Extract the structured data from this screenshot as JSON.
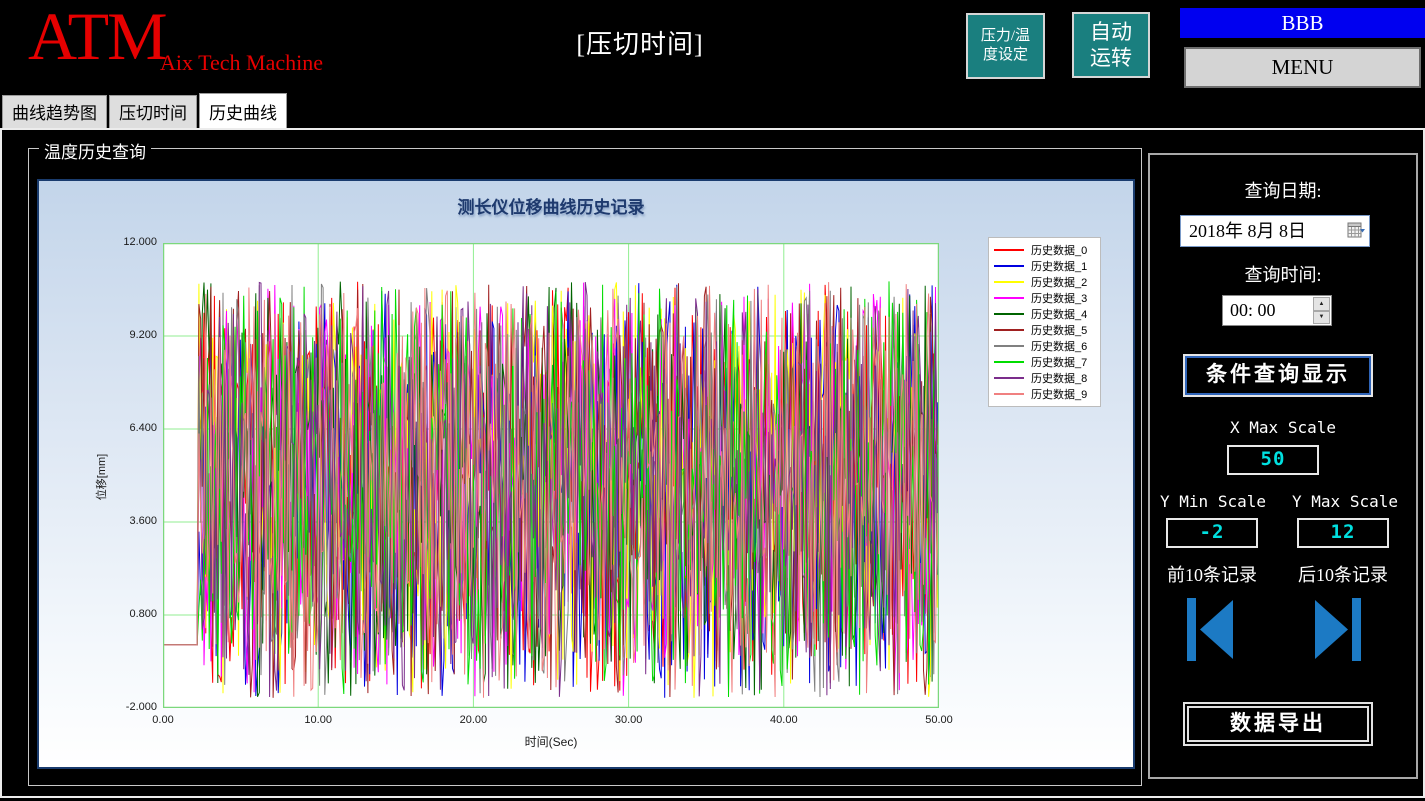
{
  "header": {
    "logo_main": "ATM",
    "logo_sub": "Aix Tech Machine",
    "page_title": "[压切时间]",
    "pressure_temp_button": [
      "压力/温",
      "度设定"
    ],
    "auto_run_button": [
      "自动",
      "运转"
    ],
    "bbb_label": "BBB",
    "menu_label": "MENU"
  },
  "tabs": [
    {
      "label": "曲线趋势图",
      "active": false
    },
    {
      "label": "压切时间",
      "active": false
    },
    {
      "label": "历史曲线",
      "active": true
    }
  ],
  "groupbox_title": "温度历史查询",
  "chart_data": {
    "type": "line",
    "title": "测长仪位移曲线历史记录",
    "xlabel": "时间(Sec)",
    "ylabel": "位移[mm]",
    "xlim": [
      0,
      50
    ],
    "ylim": [
      -2,
      12
    ],
    "x_ticks": [
      "0.00",
      "10.00",
      "20.00",
      "30.00",
      "40.00",
      "50.00"
    ],
    "y_ticks": [
      "12.000",
      "9.200",
      "6.400",
      "3.600",
      "0.800",
      "-2.000"
    ],
    "grid": true,
    "grid_color": "#90ee90",
    "plot_border_color": "#7cd87c",
    "legend_position": "top-right-outside-plot",
    "series": [
      {
        "name": "历史数据_0",
        "color": "#ff0000",
        "seed": 101
      },
      {
        "name": "历史数据_1",
        "color": "#0000e0",
        "seed": 211
      },
      {
        "name": "历史数据_2",
        "color": "#ffff00",
        "seed": 307
      },
      {
        "name": "历史数据_3",
        "color": "#ff00ff",
        "seed": 401
      },
      {
        "name": "历史数据_4",
        "color": "#006400",
        "seed": 503
      },
      {
        "name": "历史数据_5",
        "color": "#a02020",
        "seed": 607
      },
      {
        "name": "历史数据_6",
        "color": "#808080",
        "seed": 701
      },
      {
        "name": "历史数据_7",
        "color": "#00dd00",
        "seed": 809
      },
      {
        "name": "历史数据_8",
        "color": "#7b2d8b",
        "seed": 907
      },
      {
        "name": "历史数据_9",
        "color": "#f08080",
        "seed": 1009
      }
    ],
    "noise_model": {
      "description": "each series is flat then dense random oscillation read from the screenshot envelope",
      "flat_start_x": 0,
      "flat_end_x": 2.2,
      "flat_y": -0.1,
      "x_end": 50,
      "points": 430,
      "y_main": [
        -0.6,
        10.3
      ],
      "dip": [
        -1.7,
        -0.6
      ],
      "dip_prob": 0.05,
      "spike": [
        10.3,
        10.85
      ],
      "spike_prob": 0.03
    }
  },
  "right_panel": {
    "query_date_label": "查询日期:",
    "query_date_value": "2018年 8月 8日",
    "query_time_label": "查询时间:",
    "query_time_value": "00: 00",
    "query_button_label": "条件查询显示",
    "x_max_label": "X Max Scale",
    "x_max_value": "50",
    "y_min_label": "Y Min Scale",
    "y_min_value": "-2",
    "y_max_label": "Y Max Scale",
    "y_max_value": "12",
    "prev_records_label": "前10条记录",
    "next_records_label": "后10条记录",
    "export_button_label": "数据导出"
  },
  "colors": {
    "logo_red": "#e60000",
    "teal_button": "#1a7f7f",
    "bbb_bar_blue": "#0000f0",
    "menu_gray": "#d4d4d4",
    "value_cyan": "#00e0e0",
    "arrow_blue": "#1c7ac4",
    "chart_title_navy": "#1e3a6e"
  }
}
